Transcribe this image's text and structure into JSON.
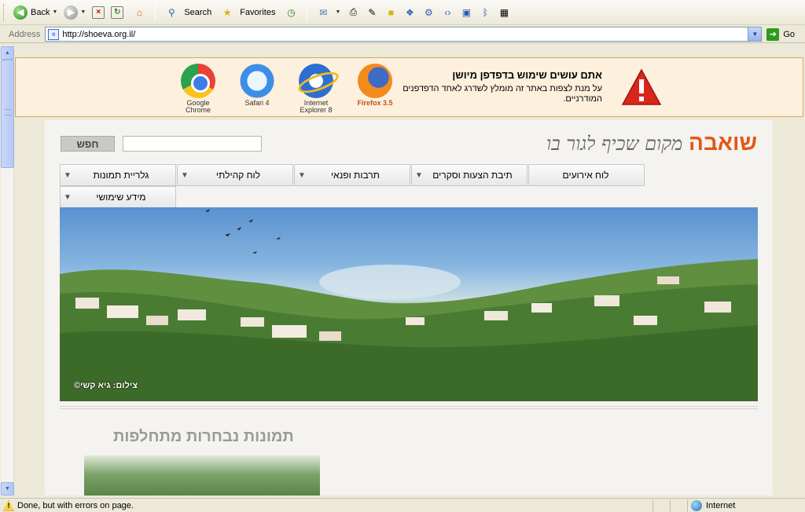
{
  "toolbar": {
    "back": "Back",
    "search": "Search",
    "favorites": "Favorites"
  },
  "address": {
    "label": "Address",
    "url": "http://shoeva.org.il/",
    "go": "Go"
  },
  "banner": {
    "title": "אתם עושים שימוש בדפדפן מיושן",
    "text": "על מנת לצפות באתר זה מומלץ לשדרג לאחד הדפדפנים המודרניים.",
    "browsers": [
      {
        "name": "Google Chrome"
      },
      {
        "name": "Safari 4"
      },
      {
        "name": "Internet Explorer 8"
      },
      {
        "name": "Firefox 3.5"
      }
    ]
  },
  "site": {
    "name": "שואבה",
    "slogan": "מקום שכיף לגור בו",
    "search_button": "חפש",
    "nav": [
      "לוח אירועים",
      "תיבת הצעות וסקרים",
      "תרבות ופנאי",
      "לוח קהילתי",
      "גלריית תמונות",
      "מידע שימושי"
    ],
    "photo_credit": "צילום: גיא קשי©",
    "section_title": "תמונות נבחרות מתחלפות"
  },
  "status": {
    "text": "Done, but with errors on page.",
    "zone": "Internet"
  }
}
